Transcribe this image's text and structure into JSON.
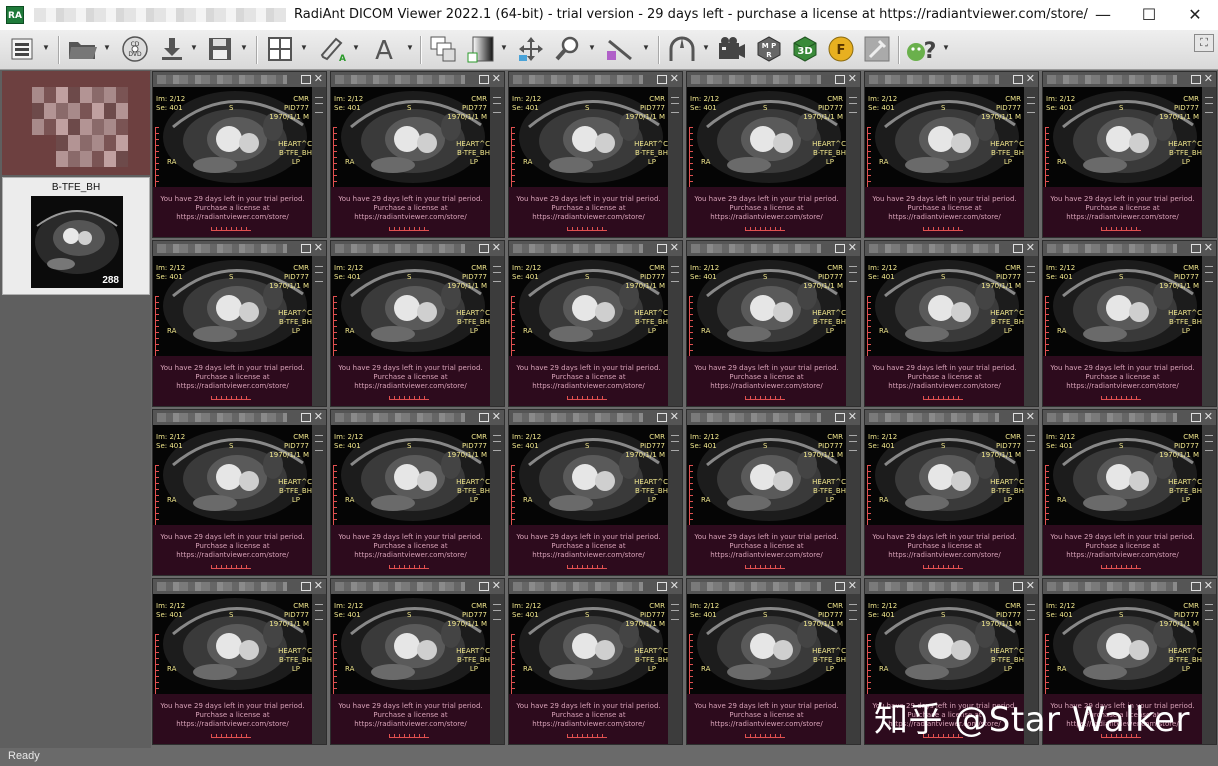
{
  "window": {
    "app_icon_text": "RA",
    "title": "RadiAnt DICOM Viewer 2022.1 (64-bit) - trial version - 29 days left - purchase a license at https://radiantviewer.com/store/",
    "minimize_symbol": "—",
    "maximize_symbol": "☐",
    "close_symbol": "✕"
  },
  "toolbar": {
    "buttons": [
      "menu",
      "open",
      "cd-dvd",
      "download",
      "save",
      "layout",
      "annotate",
      "text",
      "compare",
      "window-level",
      "pan",
      "zoom",
      "measure",
      "reset",
      "cine",
      "mpr",
      "3d",
      "fusion",
      "tools",
      "help"
    ],
    "cd_label": "CD\nDVD",
    "corner_symbol": "⛶"
  },
  "sidebar": {
    "series": [
      {
        "label": "",
        "count": ""
      },
      {
        "label": "B-TFE_BH",
        "count": "288"
      }
    ]
  },
  "viewport": {
    "image_number": "Im: 2/12",
    "series_number": "Se: 401",
    "modality": "CMR",
    "patient_id": "PID777",
    "birth_info": "1970/1/1 M",
    "body_part": "HEART^C",
    "protocol": "B-TFE_BH",
    "orient_top": "S",
    "orient_left": "RA",
    "orient_right": "LP",
    "trial_line1": "You have 29 days left in your trial period.",
    "trial_line2": "Purchase a license at",
    "trial_line3": "https://radiantviewer.com/store/",
    "close_symbol": "✕"
  },
  "grid": {
    "rows": 4,
    "cols": 6
  },
  "status": {
    "text": "Ready"
  },
  "watermark": {
    "text": "知乎 @Star Walker"
  },
  "colors": {
    "overlay_text": "#f0e68c",
    "trial_text": "#d8a2b8",
    "trial_bg": "#2d0b1d",
    "pane_header": "#555555",
    "viewer_bg": "#6a6a6a"
  }
}
